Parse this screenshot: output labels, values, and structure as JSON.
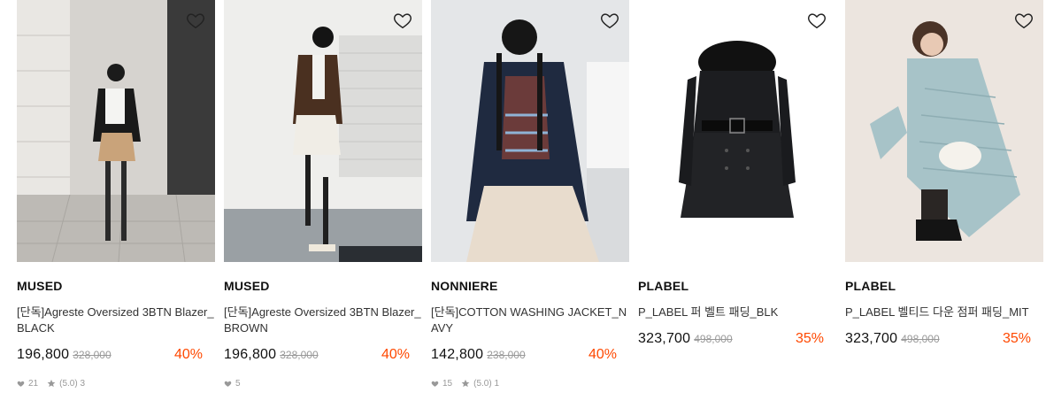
{
  "products": [
    {
      "brand": "MUSED",
      "title": "[단독]Agreste Oversized 3BTN Blazer_BLACK",
      "price": "196,800",
      "original_price": "328,000",
      "discount": "40%",
      "likes": "21",
      "rating": "(5.0)",
      "reviews": "3"
    },
    {
      "brand": "MUSED",
      "title": "[단독]Agreste Oversized 3BTN Blazer_BROWN",
      "price": "196,800",
      "original_price": "328,000",
      "discount": "40%",
      "likes": "5"
    },
    {
      "brand": "NONNIERE",
      "title": "[단독]COTTON WASHING JACKET_NAVY",
      "price": "142,800",
      "original_price": "238,000",
      "discount": "40%",
      "likes": "15",
      "rating": "(5.0)",
      "reviews": "1"
    },
    {
      "brand": "PLABEL",
      "title": "P_LABEL 퍼 벨트 패딩_BLK",
      "price": "323,700",
      "original_price": "498,000",
      "discount": "35%"
    },
    {
      "brand": "PLABEL",
      "title": "P_LABEL 벨티드 다운 점퍼 패딩_MIT",
      "price": "323,700",
      "original_price": "498,000",
      "discount": "35%"
    }
  ],
  "icons": {
    "wishlist": "heart-outline-icon",
    "likes": "heart-filled-icon",
    "rating": "star-icon"
  },
  "colors": {
    "discount": "#ff4800",
    "muted": "#999999"
  }
}
